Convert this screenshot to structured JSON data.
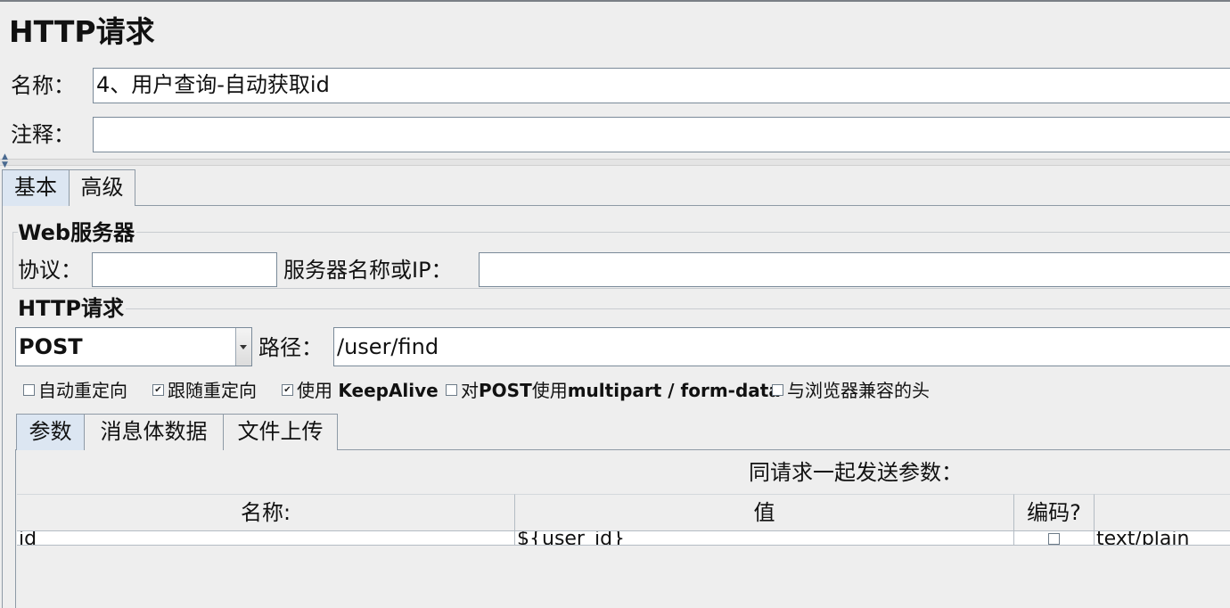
{
  "window": {
    "title": "HTTP请求"
  },
  "form": {
    "name_label": "名称：",
    "name_value": "4、用户查询-自动获取id",
    "comment_label": "注释：",
    "comment_value": ""
  },
  "tabs": [
    {
      "label": "基本",
      "active": true
    },
    {
      "label": "高级",
      "active": false
    }
  ],
  "web_server": {
    "title": "Web服务器",
    "protocol_label": "协议：",
    "protocol_value": "",
    "server_label": "服务器名称或IP：",
    "server_value": ""
  },
  "http_request": {
    "title": "HTTP请求",
    "method": "POST",
    "path_label": "路径：",
    "path_value": "/user/find"
  },
  "options": [
    {
      "label": "自动重定向",
      "checked": false
    },
    {
      "label": "跟随重定向",
      "checked": true
    },
    {
      "label_prefix": "使用 ",
      "label_bold": "KeepAlive",
      "checked": true
    },
    {
      "label_prefix": "对",
      "label_bold": "POST",
      "label_mid": "使用",
      "label_bold2": "multipart / form-data",
      "checked": false
    },
    {
      "label": "与浏览器兼容的头",
      "checked": false
    }
  ],
  "sub_tabs": [
    {
      "label": "参数",
      "active": true
    },
    {
      "label": "消息体数据",
      "active": false
    },
    {
      "label": "文件上传",
      "active": false
    }
  ],
  "params_table": {
    "caption": "同请求一起发送参数：",
    "headers": [
      "名称:",
      "值",
      "编码?",
      ""
    ],
    "rows": [
      {
        "name": "id",
        "value": "${user_id}",
        "encode": false,
        "content_type": "text/plain"
      }
    ]
  },
  "colors": {
    "background": "#eeeeee",
    "active_tab": "#dce6f2",
    "field_border": "#7a8a99"
  }
}
